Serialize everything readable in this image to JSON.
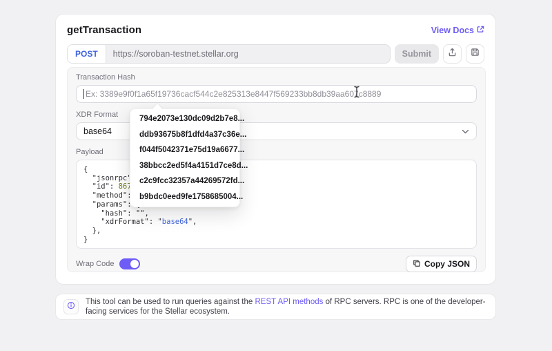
{
  "colors": {
    "accent_purple": "#6D5CF5",
    "post_blue": "#3E63DD",
    "code_number_green": "#6F7D1E",
    "code_value_blue": "#3E63DD"
  },
  "header": {
    "title": "getTransaction",
    "view_docs_label": "View Docs"
  },
  "request_bar": {
    "method": "POST",
    "url": "https://soroban-testnet.stellar.org",
    "submit_label": "Submit"
  },
  "transaction_hash": {
    "label": "Transaction Hash",
    "value": "",
    "placeholder": "Ex: 3389e9f0f1a65f19736cacf544c2e825313e8447f569233bb8db39aa607c8889"
  },
  "hash_dropdown": {
    "items": [
      "794e2073e130dc09d2b7e8...",
      "ddb93675b8f1dfd4a37c36e...",
      "f044f5042371e75d19a6677...",
      "38bbcc2ed5f4a4151d7ce8d...",
      "c2c9fcc32357a44269572fd...",
      "b9bdc0eed9fe1758685004..."
    ]
  },
  "xdr_format": {
    "label": "XDR Format",
    "selected": "base64"
  },
  "payload": {
    "label": "Payload",
    "lines": [
      {
        "parts": [
          {
            "text": "{"
          }
        ]
      },
      {
        "parts": [
          {
            "text": "  \"jsonrpc\": "
          }
        ]
      },
      {
        "parts": [
          {
            "text": "  \"id\": "
          },
          {
            "text": "86753",
            "color": "num"
          }
        ]
      },
      {
        "parts": [
          {
            "text": "  \"method\": \""
          }
        ]
      },
      {
        "parts": [
          {
            "text": "  \"params\": {"
          }
        ]
      },
      {
        "parts": [
          {
            "text": "    \"hash\": \"\","
          }
        ]
      },
      {
        "parts": [
          {
            "text": "    \"xdrFormat\": \""
          },
          {
            "text": "base64",
            "color": "str"
          },
          {
            "text": "\","
          }
        ]
      },
      {
        "parts": [
          {
            "text": "  },"
          }
        ]
      },
      {
        "parts": [
          {
            "text": "}"
          }
        ]
      }
    ]
  },
  "panel_footer": {
    "wrap_code_label": "Wrap Code",
    "wrap_code_on": true,
    "copy_json_label": "Copy JSON"
  },
  "info_bar": {
    "text_before_link": "This tool can be used to run queries against the ",
    "link_text": "REST API methods",
    "text_after_link": " of RPC servers. RPC is one of the developer-facing services for the Stellar ecosystem."
  }
}
